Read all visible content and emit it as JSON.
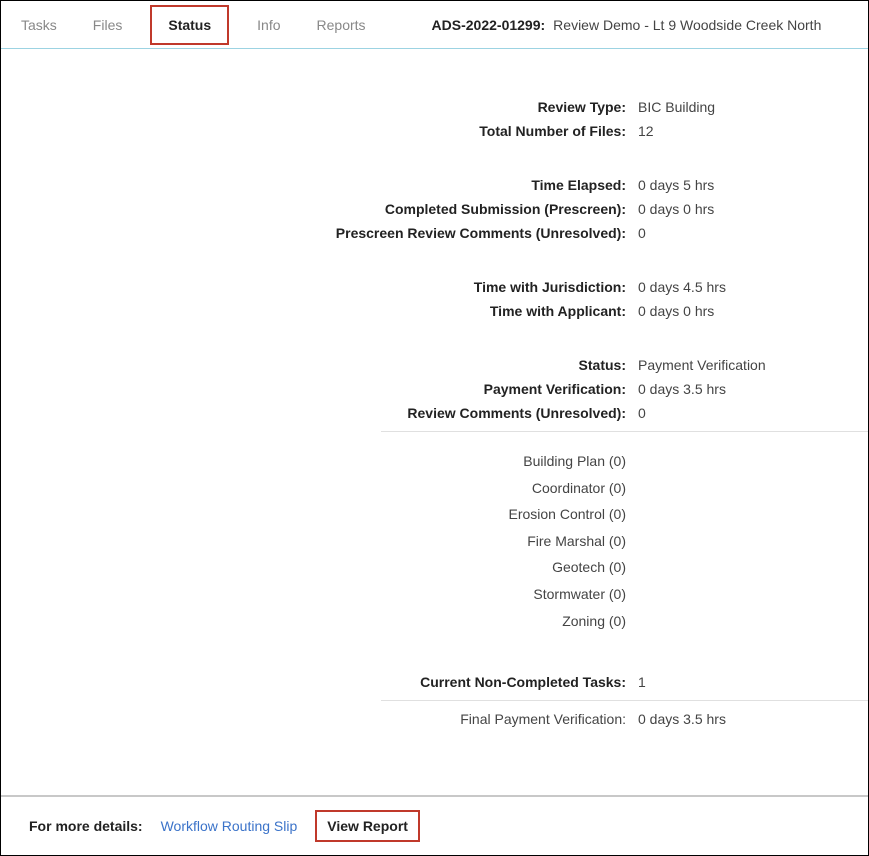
{
  "tabs": {
    "tasks": "Tasks",
    "files": "Files",
    "status": "Status",
    "info": "Info",
    "reports": "Reports"
  },
  "case": {
    "id": "ADS-2022-01299:",
    "title": "Review Demo - Lt 9 Woodside Creek North"
  },
  "fields": {
    "review_type_label": "Review Type:",
    "review_type_value": "BIC Building",
    "total_files_label": "Total Number of Files:",
    "total_files_value": "12",
    "time_elapsed_label": "Time Elapsed:",
    "time_elapsed_value": "0 days 5 hrs",
    "completed_submission_label": "Completed Submission (Prescreen):",
    "completed_submission_value": "0 days 0 hrs",
    "prescreen_comments_label": "Prescreen Review Comments (Unresolved):",
    "prescreen_comments_value": "0",
    "time_jurisdiction_label": "Time with Jurisdiction:",
    "time_jurisdiction_value": "0 days 4.5 hrs",
    "time_applicant_label": "Time with Applicant:",
    "time_applicant_value": "0 days 0 hrs",
    "status_label": "Status:",
    "status_value": "Payment Verification",
    "payment_verification_label": "Payment Verification:",
    "payment_verification_value": "0 days 3.5 hrs",
    "review_comments_label": "Review Comments (Unresolved):",
    "review_comments_value": "0",
    "subitems": {
      "building_plan": "Building Plan (0)",
      "coordinator": "Coordinator (0)",
      "erosion_control": "Erosion Control (0)",
      "fire_marshal": "Fire Marshal (0)",
      "geotech": "Geotech (0)",
      "stormwater": "Stormwater (0)",
      "zoning": "Zoning (0)"
    },
    "non_completed_label": "Current Non-Completed Tasks:",
    "non_completed_value": "1",
    "final_payment_label": "Final Payment Verification:",
    "final_payment_value": "0 days 3.5 hrs"
  },
  "footer": {
    "for_more": "For more details:",
    "workflow_link": "Workflow Routing Slip",
    "view_report": "View Report"
  }
}
